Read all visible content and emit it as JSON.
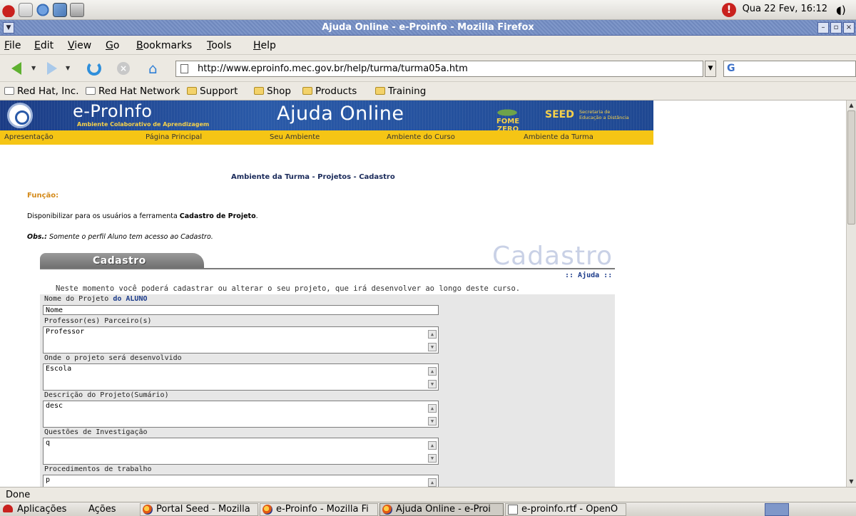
{
  "top_panel": {
    "clock": "Qua 22 Fev, 16:12",
    "launchers": [
      "redhat-launcher",
      "mail-launcher",
      "web-launcher",
      "office-launcher",
      "print-launcher"
    ]
  },
  "window": {
    "title": "Ajuda Online - e-Proinfo - Mozilla Firefox"
  },
  "menu": {
    "items": [
      "File",
      "Edit",
      "View",
      "Go",
      "Bookmarks",
      "Tools",
      "Help"
    ]
  },
  "navigation": {
    "url": "http://www.eproinfo.mec.gov.br/help/turma/turma05a.htm"
  },
  "bookmarks": [
    {
      "label": "Red Hat, Inc.",
      "type": "page"
    },
    {
      "label": "Red Hat Network",
      "type": "page"
    },
    {
      "label": "Support",
      "type": "folder"
    },
    {
      "label": "Shop",
      "type": "folder"
    },
    {
      "label": "Products",
      "type": "folder"
    },
    {
      "label": "Training",
      "type": "folder"
    }
  ],
  "site": {
    "logo_title": "e-ProInfo",
    "logo_subtitle": "Ambiente Colaborativo de Aprendizagem",
    "header_title": "Ajuda Online",
    "fome_zero": "FOME ZERO",
    "seed": "SEED",
    "seed_subtitle_1": "Secretaria de",
    "seed_subtitle_2": "Educação a Distância",
    "nav": [
      "Apresentação",
      "Página Principal",
      "Seu Ambiente",
      "Ambiente do Curso",
      "Ambiente da Turma"
    ]
  },
  "page": {
    "heading": "Ambiente da Turma - Projetos - Cadastro",
    "funcao_label": "Função:",
    "funcao_text_prefix": "Disponibilizar para os usuários a ferramenta ",
    "funcao_text_bold": "Cadastro de Projeto",
    "funcao_text_suffix": ".",
    "obs_label": "Obs.:",
    "obs_text": " Somente o perfil Aluno tem acesso ao Cadastro."
  },
  "form": {
    "tab_label": "Cadastro",
    "watermark": "Cadastro",
    "help_link": ":: Ajuda ::",
    "intro": "Neste momento você poderá cadastrar ou alterar o seu projeto, que irá desenvolver ao longo deste curso.",
    "nome_label": "Nome do Projeto ",
    "nome_label_bold": "do ALUNO",
    "nome_value": "Nome",
    "fields": [
      {
        "label": "Professor(es) Parceiro(s)",
        "value": "Professor"
      },
      {
        "label": "Onde o projeto será desenvolvido",
        "value": "Escola"
      },
      {
        "label": "Descrição do Projeto(Sumário)",
        "value": "desc"
      },
      {
        "label": "Questões de Investigação",
        "value": "q"
      },
      {
        "label": "Procedimentos de trabalho",
        "value": "p"
      }
    ]
  },
  "status": {
    "text": "Done"
  },
  "bottom_panel": {
    "menus": [
      "Aplicações",
      "Ações"
    ],
    "tasks": [
      {
        "label": "Portal Seed - Mozilla",
        "icon": "firefox-icon"
      },
      {
        "label": "e-Proinfo - Mozilla Fi",
        "icon": "firefox-icon"
      },
      {
        "label": "Ajuda Online - e-Proi",
        "icon": "firefox-icon"
      },
      {
        "label": "e-proinfo.rtf - OpenO",
        "icon": "document-icon"
      }
    ]
  },
  "colors": {
    "site_header": "#1f4892",
    "site_nav": "#f5c515",
    "funcao_label": "#d48a1a",
    "title_bar": "#7f97c9"
  }
}
